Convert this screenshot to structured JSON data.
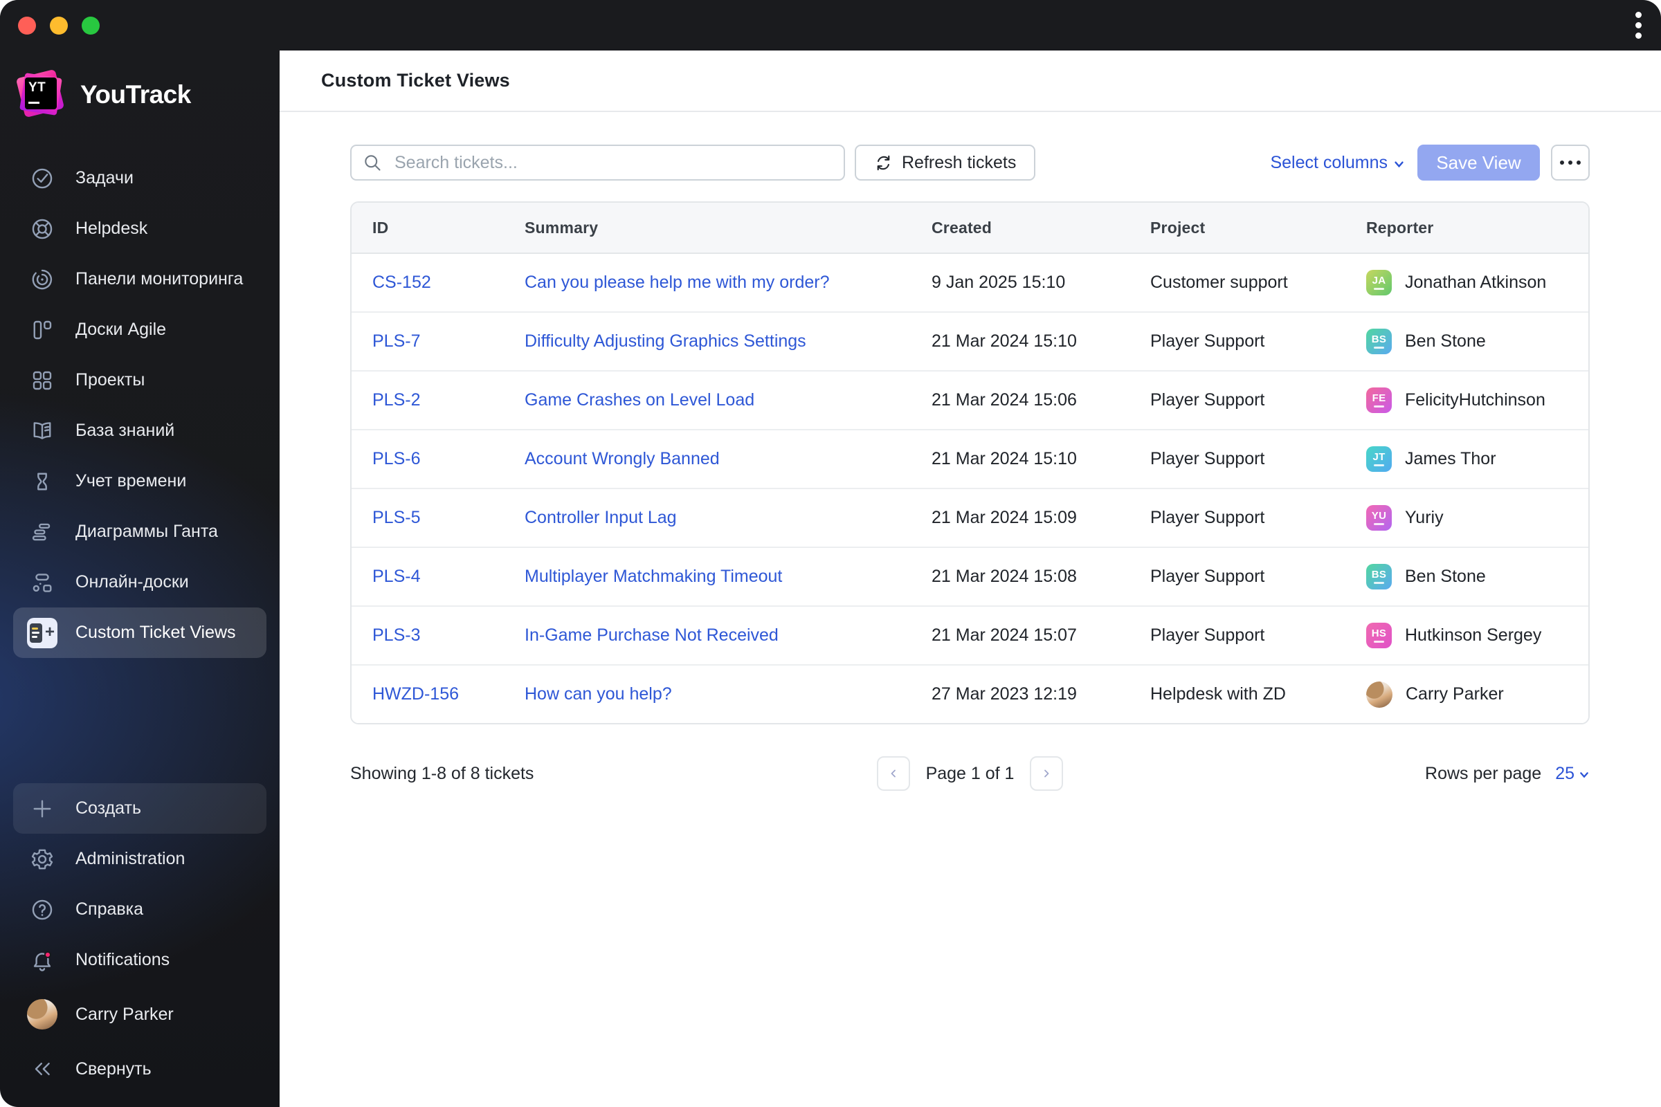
{
  "window": {
    "traffic_lights": [
      "close",
      "minimize",
      "zoom"
    ],
    "menu_icon": "kebab-menu-icon"
  },
  "sidebar": {
    "logo_text": "YouTrack",
    "logo_badge": "YT",
    "items": [
      {
        "label": "Задачи",
        "icon": "tasks"
      },
      {
        "label": "Helpdesk",
        "icon": "helpdesk"
      },
      {
        "label": "Панели мониторинга",
        "icon": "dashboards"
      },
      {
        "label": "Доски Agile",
        "icon": "agile-boards"
      },
      {
        "label": "Проекты",
        "icon": "projects"
      },
      {
        "label": "База знаний",
        "icon": "knowledge-base"
      },
      {
        "label": "Учет времени",
        "icon": "time-tracking"
      },
      {
        "label": "Диаграммы Ганта",
        "icon": "gantt"
      },
      {
        "label": "Онлайн-доски",
        "icon": "whiteboards"
      },
      {
        "label": "Custom Ticket Views",
        "icon": "custom-ticket-views",
        "active": true
      }
    ],
    "create_label": "Создать",
    "bottom_items": [
      {
        "label": "Administration",
        "icon": "gear"
      },
      {
        "label": "Справка",
        "icon": "help"
      },
      {
        "label": "Notifications",
        "icon": "bell",
        "badge": true
      },
      {
        "label": "Carry Parker",
        "icon": "avatar-photo"
      },
      {
        "label": "Свернуть",
        "icon": "collapse"
      }
    ]
  },
  "header": {
    "title": "Custom Ticket Views"
  },
  "toolbar": {
    "search_placeholder": "Search tickets...",
    "refresh_label": "Refresh tickets",
    "select_columns_label": "Select columns",
    "save_view_label": "Save View",
    "more_icon": "ellipsis-icon"
  },
  "table": {
    "columns": [
      "ID",
      "Summary",
      "Created",
      "Project",
      "Reporter"
    ],
    "rows": [
      {
        "id": "CS-152",
        "summary": "Can you please help me with my order?",
        "created": "9 Jan 2025 15:10",
        "project": "Customer support",
        "reporter": {
          "initials": "JA",
          "name": "Jonathan Atkinson",
          "avatar": [
            "#c6d75f",
            "#62c86d"
          ]
        }
      },
      {
        "id": "PLS-7",
        "summary": "Difficulty Adjusting Graphics Settings",
        "created": "21 Mar 2024 15:10",
        "project": "Player Support",
        "reporter": {
          "initials": "BS",
          "name": "Ben Stone",
          "avatar": [
            "#52d6a0",
            "#5aaaf0"
          ]
        }
      },
      {
        "id": "PLS-2",
        "summary": "Game Crashes on Level Load",
        "created": "21 Mar 2024 15:06",
        "project": "Player Support",
        "reporter": {
          "initials": "FE",
          "name": "FelicityHutchinson",
          "avatar": [
            "#f2699c",
            "#c95ae8"
          ]
        }
      },
      {
        "id": "PLS-6",
        "summary": "Account Wrongly Banned",
        "created": "21 Mar 2024 15:10",
        "project": "Player Support",
        "reporter": {
          "initials": "JT",
          "name": "James Thor",
          "avatar": [
            "#48d6c8",
            "#52aaf0"
          ]
        }
      },
      {
        "id": "PLS-5",
        "summary": "Controller Input Lag",
        "created": "21 Mar 2024 15:09",
        "project": "Player Support",
        "reporter": {
          "initials": "YU",
          "name": "Yuriy",
          "avatar": [
            "#f268b4",
            "#b266f0"
          ]
        }
      },
      {
        "id": "PLS-4",
        "summary": "Multiplayer Matchmaking Timeout",
        "created": "21 Mar 2024 15:08",
        "project": "Player Support",
        "reporter": {
          "initials": "BS",
          "name": "Ben Stone",
          "avatar": [
            "#52d6a0",
            "#5aaaf0"
          ]
        }
      },
      {
        "id": "PLS-3",
        "summary": "In-Game Purchase Not Received",
        "created": "21 Mar 2024 15:07",
        "project": "Player Support",
        "reporter": {
          "initials": "HS",
          "name": "Hutkinson Sergey",
          "avatar": [
            "#f06ab0",
            "#e052c8"
          ]
        }
      },
      {
        "id": "HWZD-156",
        "summary": "How can you help?",
        "created": "27 Mar 2023 12:19",
        "project": "Helpdesk with ZD",
        "reporter": {
          "initials": "",
          "name": "Carry Parker",
          "avatar": "photo"
        }
      }
    ]
  },
  "footer": {
    "showing_text": "Showing 1-8 of 8 tickets",
    "prev_icon": "chevron-left-icon",
    "page_text": "Page 1 of 1",
    "next_icon": "chevron-right-icon",
    "rows_per_page_label": "Rows per page",
    "rows_per_page_value": "25"
  },
  "colors": {
    "link_blue": "#2e57d6",
    "accent_blue": "#2b53d6",
    "save_view_bg": "#93a7f0",
    "notification_dot": "#f5256e",
    "sidebar_bg": "#1a1b1e",
    "table_header_bg": "#f6f7f9",
    "traffic_red": "#ff5f57",
    "traffic_yellow": "#febc2e",
    "traffic_green": "#28c840"
  }
}
